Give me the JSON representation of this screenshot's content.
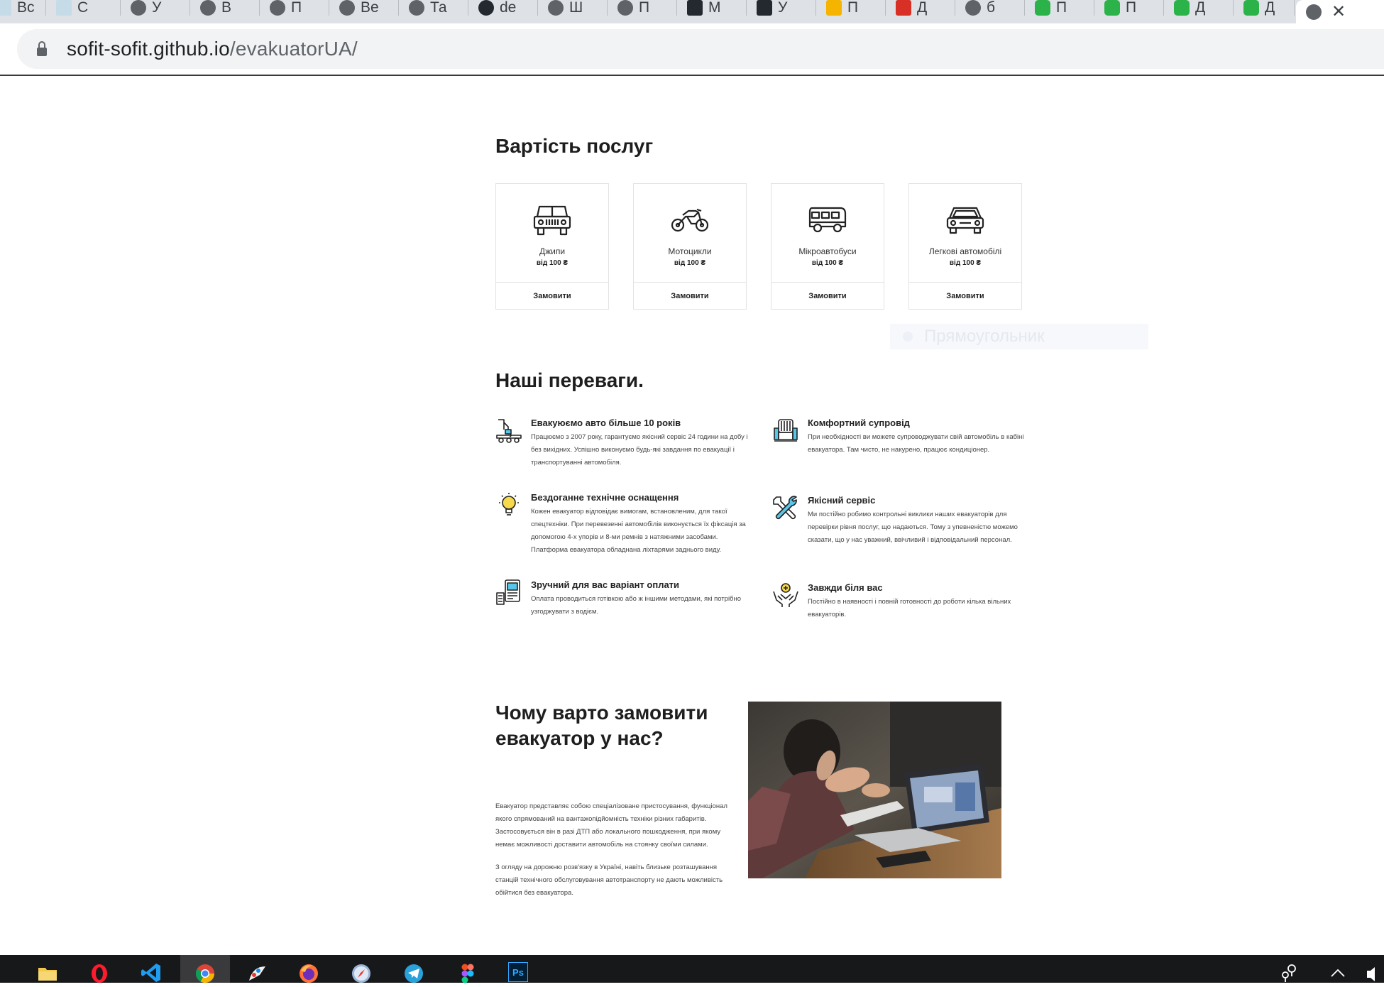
{
  "browser": {
    "tabs": [
      {
        "label": "Вс",
        "favicon": "pale-doc-icon"
      },
      {
        "label": "С",
        "favicon": "pale-doc-icon"
      },
      {
        "label": "У",
        "favicon": "globe-icon"
      },
      {
        "label": "В",
        "favicon": "globe-icon"
      },
      {
        "label": "П",
        "favicon": "globe-icon"
      },
      {
        "label": "Ве",
        "favicon": "globe-icon"
      },
      {
        "label": "Та",
        "favicon": "globe-icon"
      },
      {
        "label": "de",
        "favicon": "github-icon"
      },
      {
        "label": "Ш",
        "favicon": "globe-icon"
      },
      {
        "label": "П",
        "favicon": "globe-icon"
      },
      {
        "label": "М",
        "favicon": "dark-icon"
      },
      {
        "label": "У",
        "favicon": "dark-icon"
      },
      {
        "label": "П",
        "favicon": "yellow-icon"
      },
      {
        "label": "Д",
        "favicon": "gmail-icon"
      },
      {
        "label": "б",
        "favicon": "globe-icon"
      },
      {
        "label": "П",
        "favicon": "green-icon"
      },
      {
        "label": "П",
        "favicon": "green-icon"
      },
      {
        "label": "Д",
        "favicon": "green-icon"
      },
      {
        "label": "Д",
        "favicon": "green-icon"
      }
    ],
    "active_tab": {
      "label": "",
      "close": "✕"
    },
    "url_host": "sofit-sofit.github.io",
    "url_path": "/evakuatorUA/"
  },
  "pricing": {
    "title": "Вартість послуг",
    "cards": [
      {
        "name": "Джипи",
        "price": "від 100 ₴",
        "button": "Замовити",
        "icon": "jeep-icon"
      },
      {
        "name": "Мотоцикли",
        "price": "від 100 ₴",
        "button": "Замовити",
        "icon": "motorcycle-icon"
      },
      {
        "name": "Мікроавтобуси",
        "price": "від 100 ₴",
        "button": "Замовити",
        "icon": "minibus-icon"
      },
      {
        "name": "Легкові автомобілі",
        "price": "від 100 ₴",
        "button": "Замовити",
        "icon": "car-icon"
      }
    ],
    "ghost_label": "Прямоугольник"
  },
  "advantages": {
    "title": "Наші переваги.",
    "items": [
      {
        "title": "Евакуюємо авто більше 10 років",
        "text": "Працюємо з 2007 року, гарантуємо якісний сервіс 24 години на добу і без вихідних. Успішно виконуємо будь-які завдання по евакуації і транспортуванні автомобіля.",
        "icon": "tow-truck-icon"
      },
      {
        "title": "Комфортний супровід",
        "text": "При необхідності ви можете супроводжувати свій автомобіль в кабіні евакуатора. Там чисто, не накурено, працює кондиціонер.",
        "icon": "seat-icon"
      },
      {
        "title": "Бездоганне технічне оснащення",
        "text": "Кожен евакуатор відповідає вимогам, встановленим, для такої спецтехніки. При перевезенні автомобілів виконується їх фіксація за допомогою 4-х упорів и 8-ми ремнів з натяжними засобами. Платформа евакуатора обладнана ліхтарями заднього виду.",
        "icon": "lightbulb-icon"
      },
      {
        "title": "Якісний сервіс",
        "text": "Ми постійно робимо контрольні виклики наших евакуаторів для перевірки рівня послуг, що надаються. Тому з упевненістю можемо сказати, що у нас уважний, ввічливий і відповідальний персонал.",
        "icon": "tools-icon"
      },
      {
        "title": "Зручний для вас варіант оплати",
        "text": "Оплата проводиться готівкою або ж іншими методами, які потрібно узгоджувати з водієм.",
        "icon": "payment-icon"
      },
      {
        "title": "Завжди біля вас",
        "text": "Постійно в наявності і повній готовності до роботи кілька вільних евакуаторів.",
        "icon": "hands-icon"
      }
    ]
  },
  "why": {
    "title": "Чому варто замовити евакуатор у нас?",
    "p1": "Евакуатор представляє собою спеціалізоване пристосування, функціонал якого спрямований на вантажопідйомність техніки різних габаритів. Застосовується він в разі ДТП або локального пошкодження, при якому немає можливості доставити автомобіль на стоянку своїми силами.",
    "p2": "З огляду на дорожню розв'язку в Україні, навіть близьке розташування станцій технічного обслуговування автотранспорту не дають можливість обійтися без евакуатора."
  },
  "taskbar": {
    "apps": [
      "folder-icon",
      "opera-icon",
      "vscode-icon",
      "chrome-icon",
      "paint-icon",
      "firefox-icon",
      "safari-icon",
      "telegram-icon",
      "figma-icon",
      "photoshop-icon"
    ],
    "photoshop_label": "Ps"
  },
  "colors": {
    "accent": "#1e1e1e",
    "icon_stroke": "#222222",
    "icon_fill": "#58c6e8",
    "bulb": "#f7d94c"
  }
}
